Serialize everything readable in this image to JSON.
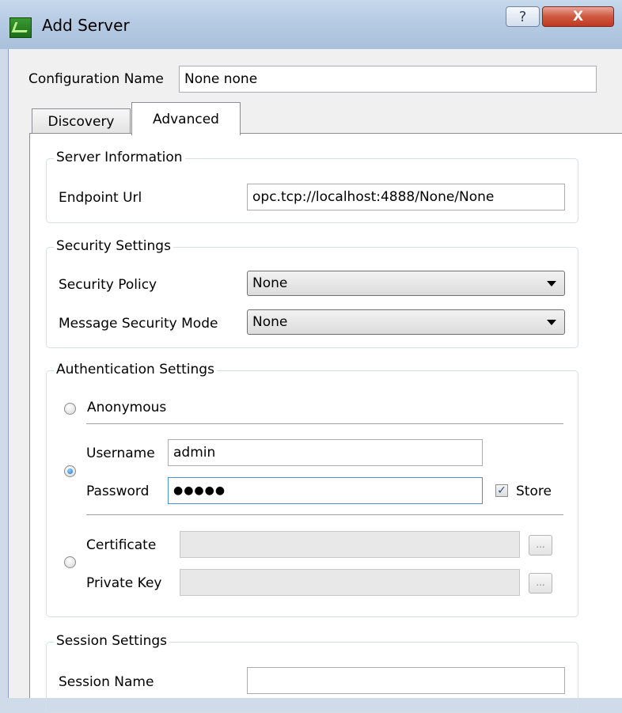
{
  "window": {
    "title": "Add Server",
    "help_label": "?",
    "close_label": "X"
  },
  "config": {
    "label": "Configuration Name",
    "value": "None none"
  },
  "tabs": [
    {
      "label": "Discovery"
    },
    {
      "label": "Advanced"
    }
  ],
  "server_info": {
    "title": "Server Information",
    "endpoint_label": "Endpoint Url",
    "endpoint_value": "opc.tcp://localhost:4888/None/None"
  },
  "security": {
    "title": "Security Settings",
    "policy_label": "Security Policy",
    "policy_value": "None",
    "mode_label": "Message Security Mode",
    "mode_value": "None"
  },
  "auth": {
    "title": "Authentication Settings",
    "anonymous_label": "Anonymous",
    "username_label": "Username",
    "username_value": "admin",
    "password_label": "Password",
    "password_value": "●●●●●",
    "store_label": "Store",
    "store_checked": "✓",
    "certificate_label": "Certificate",
    "private_key_label": "Private Key",
    "browse_label": "..."
  },
  "session": {
    "title": "Session Settings",
    "name_label": "Session Name",
    "name_value": ""
  }
}
